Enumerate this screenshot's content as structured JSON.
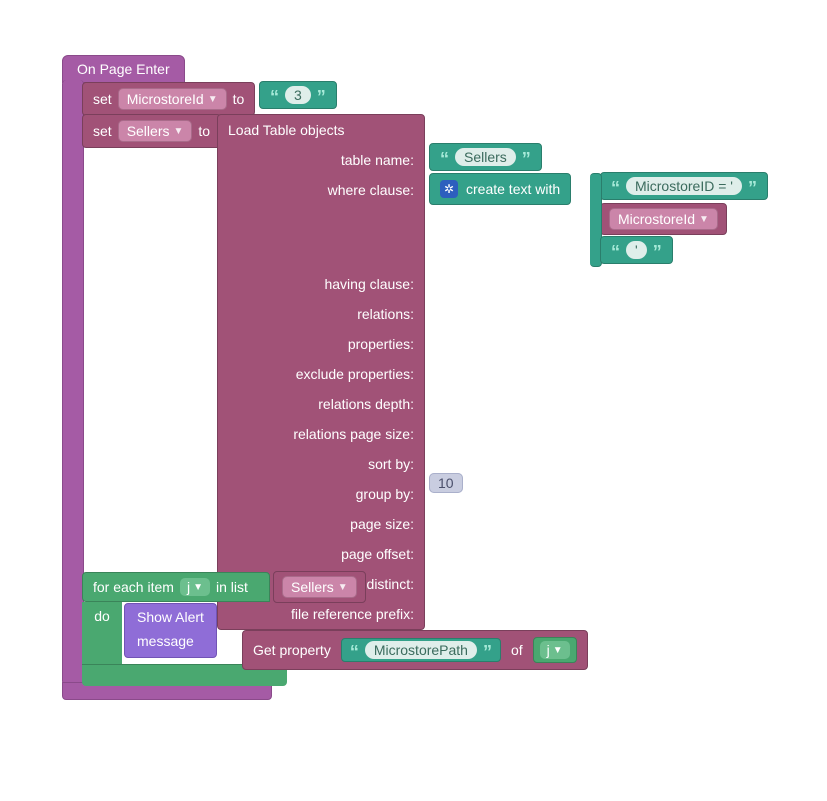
{
  "event": {
    "title": "On Page Enter"
  },
  "set1": {
    "label_set": "set",
    "var": "MicrostoreId",
    "label_to": "to",
    "value": "3"
  },
  "set2": {
    "label_set": "set",
    "var": "Sellers",
    "label_to": "to"
  },
  "load": {
    "title": "Load Table objects",
    "rows": {
      "table_name": "table name:",
      "where_clause": "where clause:",
      "having_clause": "having clause:",
      "relations": "relations:",
      "properties": "properties:",
      "exclude_properties": "exclude properties:",
      "relations_depth": "relations depth:",
      "relations_page_size": "relations page size:",
      "sort_by": "sort by:",
      "group_by": "group by:",
      "page_size": "page size:",
      "page_offset": "page offset:",
      "distinct": "distinct:",
      "file_ref_prefix": "file reference prefix:"
    },
    "table_name_value": "Sellers",
    "page_size_value": "10"
  },
  "ctw": {
    "label": "create text with",
    "part1": "MicrostoreID = '",
    "part2_var": "MicrostoreId",
    "part3": "'"
  },
  "foreach": {
    "label_for": "for each item",
    "var": "j",
    "label_in": "in list",
    "list_var": "Sellers",
    "label_do": "do"
  },
  "alert": {
    "title": "Show Alert",
    "label_message": "message"
  },
  "getprop": {
    "label": "Get property",
    "prop": "MicrostorePath",
    "label_of": "of",
    "obj_var": "j"
  }
}
